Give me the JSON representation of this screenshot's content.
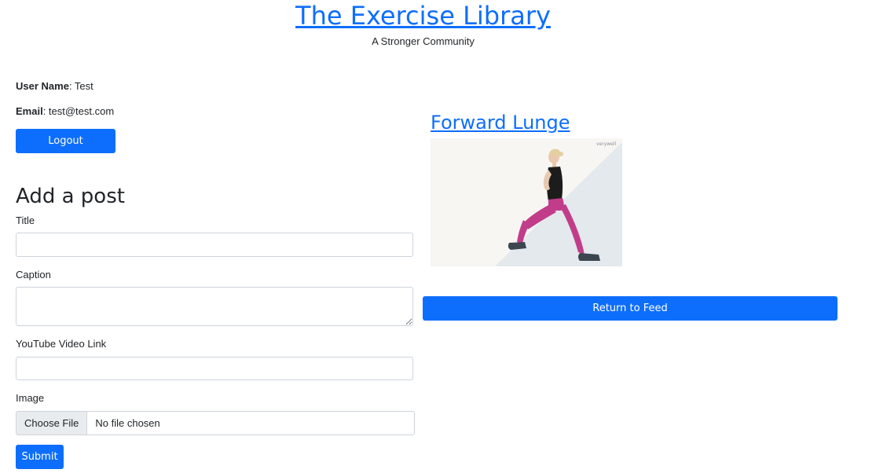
{
  "header": {
    "title": "The Exercise Library",
    "tagline": "A Stronger Community"
  },
  "user": {
    "name_label": "User Name",
    "name_value": ": Test",
    "email_label": "Email",
    "email_value": ": test@test.com",
    "logout_label": "Logout"
  },
  "form": {
    "heading": "Add a post",
    "title_label": "Title",
    "title_value": "",
    "caption_label": "Caption",
    "caption_value": "",
    "youtube_label": "YouTube Video Link",
    "youtube_value": "",
    "image_label": "Image",
    "choose_file_label": "Choose File",
    "file_status": "No file chosen",
    "submit_label": "Submit"
  },
  "post": {
    "title": "Forward Lunge",
    "image_watermark": "verywell",
    "return_label": "Return to Feed"
  },
  "colors": {
    "primary": "#0d6efd",
    "text": "#212529",
    "border": "#ced4da"
  }
}
